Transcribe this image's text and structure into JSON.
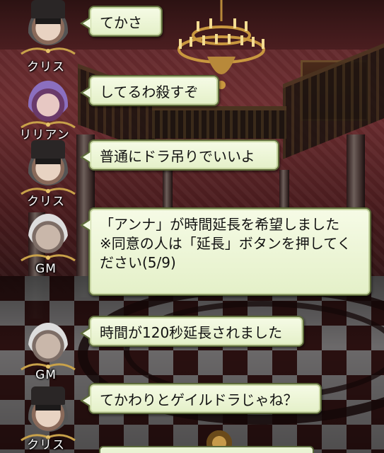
{
  "messages": [
    {
      "speaker": "クリス",
      "text": "てかさ"
    },
    {
      "speaker": "リリアン",
      "text": "してるわ殺すぞ"
    },
    {
      "speaker": "クリス",
      "text": "普通にドラ吊りでいいよ"
    },
    {
      "speaker": "GM",
      "text": "「アンナ」が時間延長を希望しました\n※同意の人は「延長」ボタンを押してください(5/9)"
    },
    {
      "speaker": "GM",
      "text": "時間が120秒延長されました"
    },
    {
      "speaker": "クリス",
      "text": "てかわりとゲイルドラじゃね？"
    }
  ],
  "colors": {
    "bubble_fill": "#eef6da",
    "bubble_border": "#5d6b3a",
    "name_text": "#ffffff"
  }
}
